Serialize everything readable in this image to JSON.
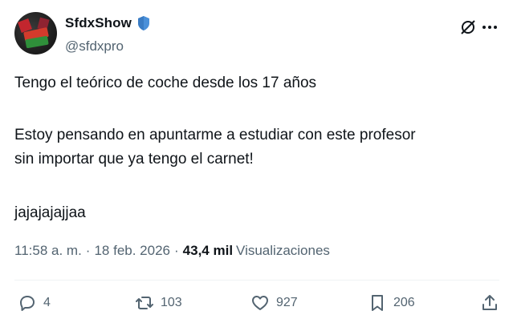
{
  "author": {
    "display_name": "SfdxShow",
    "handle": "@sfdxpro",
    "avatar_label": "SFDX SHOW",
    "verified_icon": "verified-shield-icon",
    "verified_color": "#4a90d9"
  },
  "tweet": {
    "paragraphs": [
      "Tengo el teórico de coche desde los 17 años",
      "Estoy pensando en apuntarme a estudiar con este profesor",
      "sin importar que ya tengo el carnet!",
      "jajajajajjaa"
    ]
  },
  "meta": {
    "time": "11:58 a. m.",
    "separator": "·",
    "date": "18 feb. 2026",
    "views_count": "43,4 mil",
    "views_label": "Visualizaciones"
  },
  "actions": {
    "reply_count": "4",
    "retweet_count": "103",
    "like_count": "927",
    "bookmark_count": "206"
  },
  "colors": {
    "text_primary": "#0f1419",
    "text_secondary": "#536471",
    "divider": "#eff3f4"
  }
}
